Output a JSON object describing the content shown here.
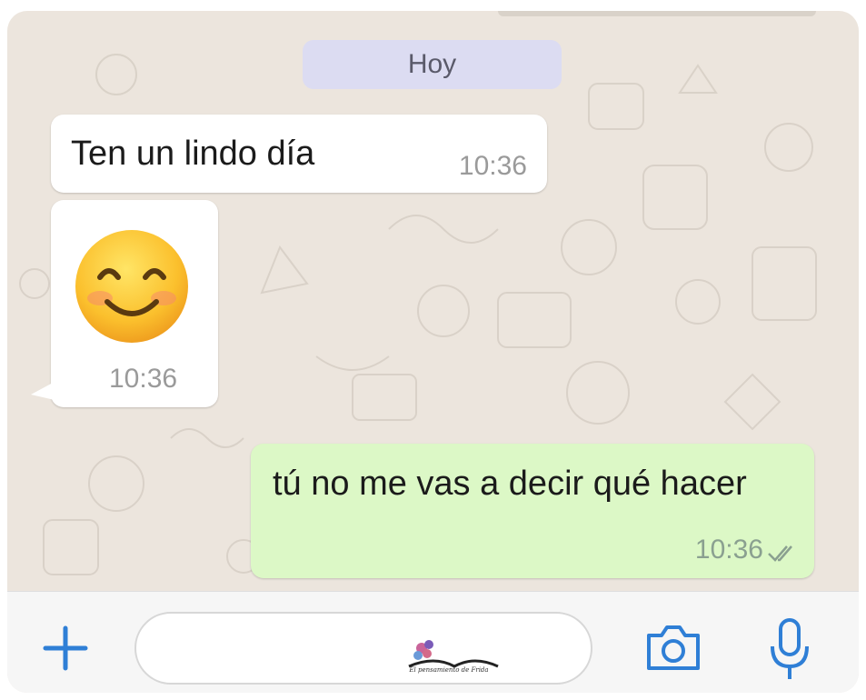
{
  "chat": {
    "date_divider": "Hoy",
    "messages": [
      {
        "direction": "incoming",
        "text": "Ten un lindo día",
        "time": "10:36"
      },
      {
        "direction": "incoming",
        "emoji": "smiling-face-with-smiling-eyes",
        "time": "10:36"
      },
      {
        "direction": "outgoing",
        "text": "tú no me vas a decir qué hacer",
        "time": "10:36",
        "status": "read-double-check"
      }
    ]
  },
  "input_bar": {
    "icons": [
      "plus-icon",
      "camera-icon",
      "microphone-icon"
    ],
    "watermark_text": "El pensamiento de Frida"
  },
  "colors": {
    "background": "#ece5dd",
    "incoming_bubble": "#ffffff",
    "outgoing_bubble": "#dcf8c6",
    "accent_blue": "#2f7fd6",
    "date_pill": "#dcdcf2"
  }
}
